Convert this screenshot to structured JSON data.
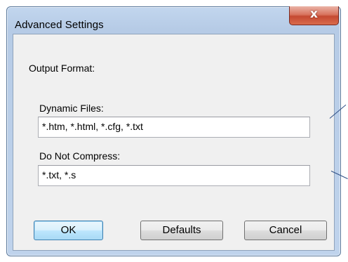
{
  "window": {
    "title": "Advanced Settings",
    "close_glyph": "x"
  },
  "form": {
    "section_label": "Output Format:",
    "dynamic_files": {
      "label": "Dynamic Files:",
      "value": "*.htm, *.html, *.cfg, *.txt"
    },
    "do_not_compress": {
      "label": "Do Not Compress:",
      "value": "*.txt, *.s"
    }
  },
  "buttons": {
    "ok": "OK",
    "defaults": "Defaults",
    "cancel": "Cancel"
  },
  "icons": {
    "close": "close-icon"
  },
  "colors": {
    "default_button_border": "#3c7fb1",
    "close_button": "#c54a32",
    "callout_line": "#2f4f86"
  }
}
